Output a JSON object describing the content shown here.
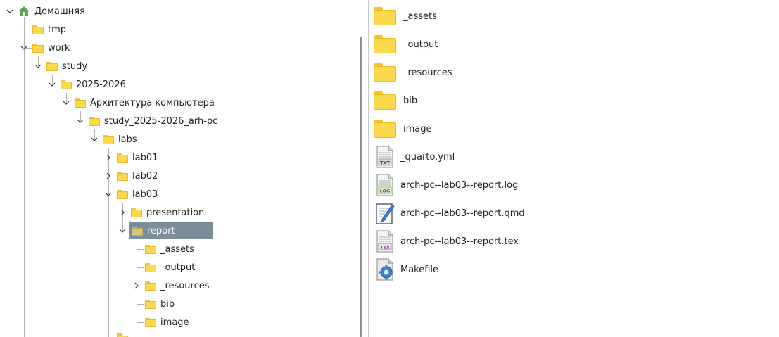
{
  "tree": {
    "items": [
      {
        "label": "Домашняя",
        "expanded": true
      },
      {
        "label": "tmp"
      },
      {
        "label": "work",
        "expanded": true
      },
      {
        "label": "study",
        "expanded": true
      },
      {
        "label": "2025-2026",
        "expanded": true
      },
      {
        "label": "Архитектура компьютера",
        "expanded": true
      },
      {
        "label": "study_2025-2026_arh-pc",
        "expanded": true
      },
      {
        "label": "labs",
        "expanded": true
      },
      {
        "label": "lab01",
        "expanded": false
      },
      {
        "label": "lab02",
        "expanded": false
      },
      {
        "label": "lab03",
        "expanded": true
      },
      {
        "label": "presentation",
        "expanded": false
      },
      {
        "label": "report",
        "expanded": true,
        "selected": true
      },
      {
        "label": "_assets"
      },
      {
        "label": "_output"
      },
      {
        "label": "_resources",
        "expanded": false
      },
      {
        "label": "bib"
      },
      {
        "label": "image"
      }
    ]
  },
  "files": {
    "items": [
      {
        "label": "_assets",
        "icon": "folder-icon"
      },
      {
        "label": "_output",
        "icon": "folder-icon"
      },
      {
        "label": "_resources",
        "icon": "folder-icon"
      },
      {
        "label": "bib",
        "icon": "folder-icon"
      },
      {
        "label": "image",
        "icon": "folder-icon"
      },
      {
        "label": "_quarto.yml",
        "icon": "txt-file-icon",
        "badge": "TXT"
      },
      {
        "label": "arch-pc--lab03--report.log",
        "icon": "log-file-icon",
        "badge": "LOG"
      },
      {
        "label": "arch-pc--lab03--report.qmd",
        "icon": "edit-file-icon"
      },
      {
        "label": "arch-pc--lab03--report.tex",
        "icon": "tex-file-icon",
        "badge": "TEX"
      },
      {
        "label": "Makefile",
        "icon": "makefile-icon"
      }
    ]
  },
  "colors": {
    "selection": "#7b8d99",
    "folder": "#fcd94d",
    "home": "#5aa84a"
  }
}
